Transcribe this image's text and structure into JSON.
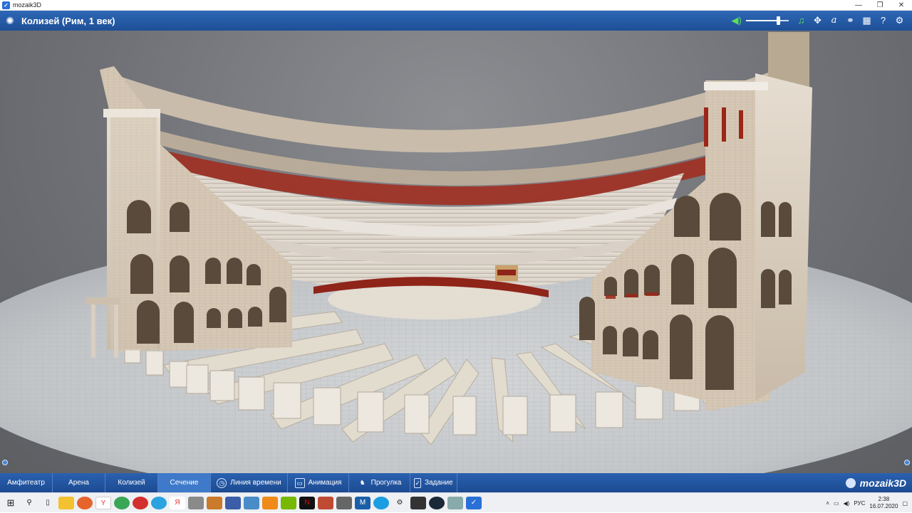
{
  "window": {
    "title": "mozaik3D",
    "controls": [
      "—",
      "❐",
      "✕"
    ]
  },
  "header": {
    "title": "Колизей (Рим, 1 век)",
    "menu_icon": "loading-spinner-icon",
    "volume_level": 0.75,
    "tools": [
      {
        "name": "music-icon",
        "glyph": "♫"
      },
      {
        "name": "move-icon",
        "glyph": "✥"
      },
      {
        "name": "text-icon",
        "glyph": "a"
      },
      {
        "name": "link-icon",
        "glyph": "⚭"
      },
      {
        "name": "grid-icon",
        "glyph": "▦"
      },
      {
        "name": "help-icon",
        "glyph": "?"
      },
      {
        "name": "settings-icon",
        "glyph": "⚙"
      }
    ]
  },
  "nav": {
    "items": [
      {
        "label": "Амфитеатр",
        "icon": ""
      },
      {
        "label": "Арена",
        "icon": ""
      },
      {
        "label": "Колизей",
        "icon": ""
      },
      {
        "label": "Сечение",
        "icon": ""
      },
      {
        "label": "Линия времени",
        "icon": "timeline-icon"
      },
      {
        "label": "Анимация",
        "icon": "tv-icon"
      },
      {
        "label": "Прогулка",
        "icon": "walk-icon"
      },
      {
        "label": "Задание",
        "icon": "task-icon"
      }
    ],
    "brand": "mozaik3D"
  },
  "taskbar": {
    "language": "РУС",
    "time": "2:38",
    "date": "16.07.2020"
  },
  "colors": {
    "header_bg": "#2e67b6",
    "nav_bg": "#2a61b0",
    "stone": "#d9cfc2",
    "brick": "#b8a58f",
    "red_accent": "#a22a1c"
  }
}
